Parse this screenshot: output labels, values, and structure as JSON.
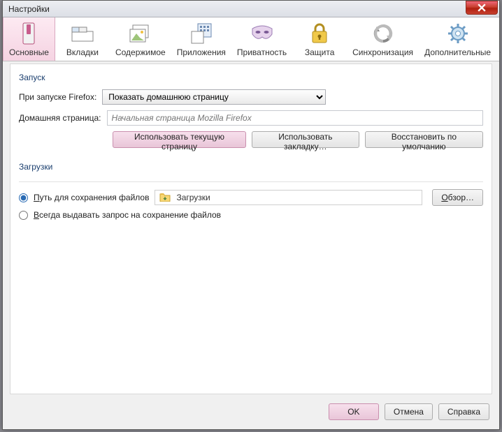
{
  "window": {
    "title": "Настройки",
    "close_name": "close"
  },
  "tabs": [
    {
      "label": "Основные"
    },
    {
      "label": "Вкладки"
    },
    {
      "label": "Содержимое"
    },
    {
      "label": "Приложения"
    },
    {
      "label": "Приватность"
    },
    {
      "label": "Защита"
    },
    {
      "label": "Синхронизация"
    },
    {
      "label": "Дополнительные"
    }
  ],
  "startup": {
    "heading": "Запуск",
    "launch_label": "При запуске Firefox:",
    "launch_value": "Показать домашнюю страницу",
    "homepage_label": "Домашняя страница:",
    "homepage_placeholder": "Начальная страница Mozilla Firefox",
    "btn_use_current": "Использовать текущую страницу",
    "btn_use_bookmark": "Использовать закладку…",
    "btn_restore_default": "Восстановить по умолчанию"
  },
  "downloads": {
    "heading": "Загрузки",
    "radio_path_prefix": "П",
    "radio_path_rest": "уть для сохранения файлов",
    "folder_value": "Загрузки",
    "browse_prefix": "О",
    "browse_rest": "бзор…",
    "radio_ask_prefix": "В",
    "radio_ask_rest": "сегда выдавать запрос на сохранение файлов"
  },
  "footer": {
    "ok": "OK",
    "cancel": "Отмена",
    "help": "Справка"
  }
}
